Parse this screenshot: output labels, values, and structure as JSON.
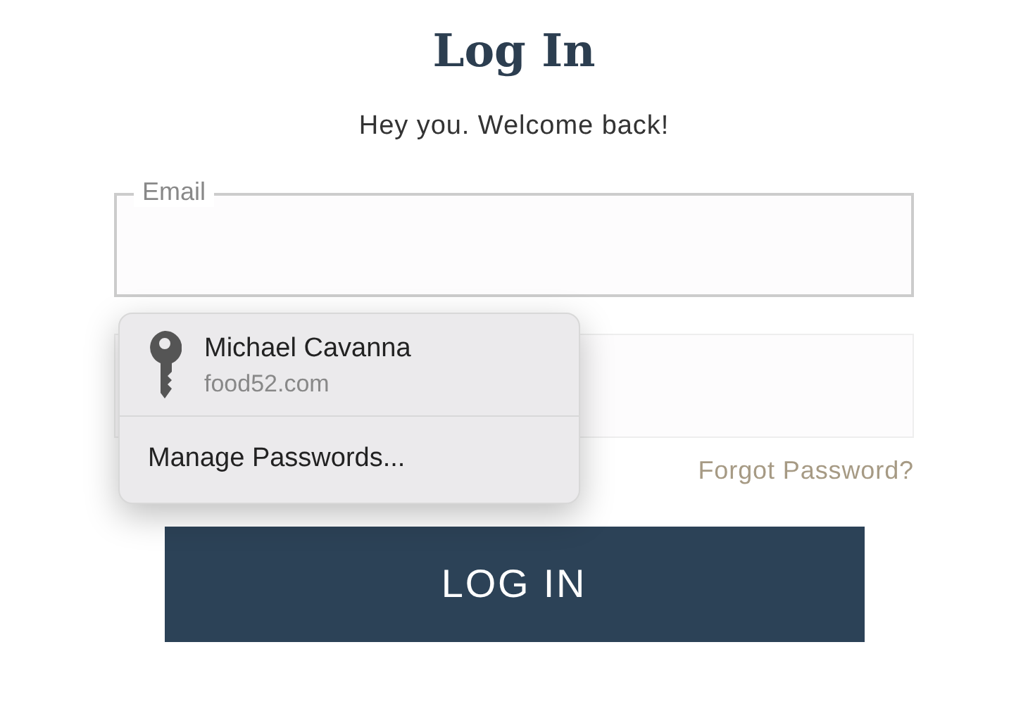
{
  "title": "Log In",
  "subtitle": "Hey you. Welcome back!",
  "email_field": {
    "label": "Email"
  },
  "forgot_link": "Forgot Password?",
  "login_button": "LOG IN",
  "autofill_popup": {
    "account": {
      "name": "Michael Cavanna",
      "site": "food52.com"
    },
    "manage": "Manage Passwords..."
  }
}
